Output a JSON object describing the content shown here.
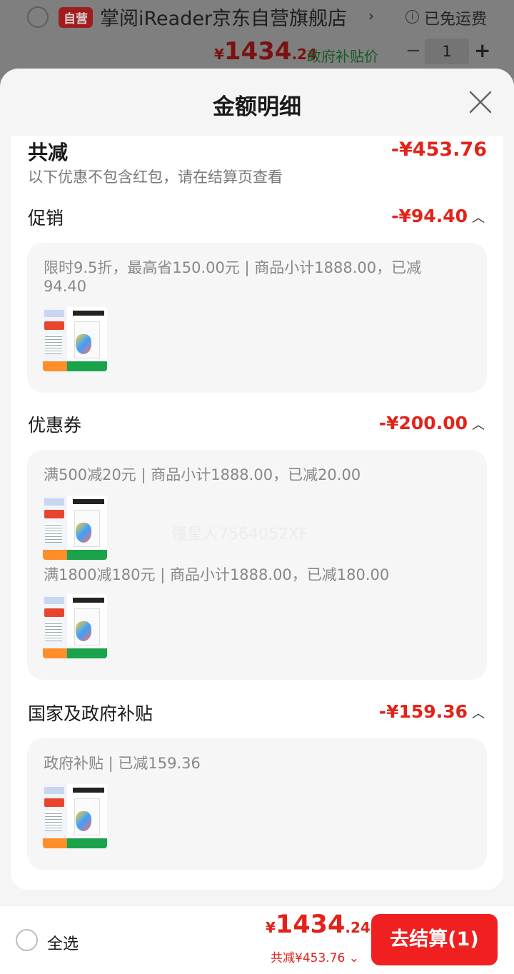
{
  "store": {
    "tag": "自营",
    "name": "掌阅iReader京东自营旗舰店",
    "chevron": "›",
    "shipping": "已免运费",
    "price_currency": "¥",
    "price_int": "1434",
    "price_dec": ".24",
    "price_label": "政府补贴价",
    "minus": "−",
    "qty": "1",
    "plus": "+"
  },
  "sheet": {
    "title": "金额明细"
  },
  "total": {
    "title": "共减",
    "amount": "-¥453.76",
    "note": "以下优惠不包含红包，请在结算页查看"
  },
  "promotion": {
    "title": "促销",
    "amount": "-¥94.40",
    "detail": "限时9.5折，最高省150.00元 | 商品小计1888.00，已减94.40"
  },
  "coupon": {
    "title": "优惠券",
    "amount": "-¥200.00",
    "detail1": "满500减20元 | 商品小计1888.00，已减20.00",
    "detail2": "满1800减180元 | 商品小计1888.00，已减180.00"
  },
  "subsidy": {
    "title": "国家及政府补贴",
    "amount": "-¥159.36",
    "detail": "政府补贴 | 已减159.36"
  },
  "watermark": "懂星人7564052XF",
  "footer": {
    "select_all": "全选",
    "price_currency": "¥",
    "price_int": "1434",
    "price_dec": ".24",
    "saved": "共减¥453.76 ⌄",
    "checkout": "去结算(1)"
  },
  "colors": {
    "accent": "#e2231a",
    "button": "#f02020"
  }
}
